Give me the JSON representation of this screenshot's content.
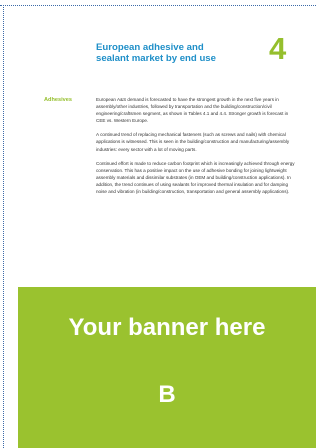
{
  "header": {
    "title_line1": "European adhesive and",
    "title_line2": "sealant market by end use",
    "chapter_number": "4"
  },
  "sidebar": {
    "label": "Adhesives"
  },
  "body": {
    "paragraphs": [
      "European A&S demand is forecasted to have the strongest growth in the next five years in assembly/other industries, followed by transportation and the building/construction/civil engineering/craftsmen segment, as shown in Tables 4.1 and 4.4. Stronger growth is forecast in CEE vs. Western Europe.",
      "A continued trend of replacing mechanical fasteners (such as screws and nails) with chemical applications is witnessed. This is seen in the building/construction and manufacturing/assembly industries: every sector with a lot of moving parts.",
      "Continued effort is made to reduce carbon footprint which is increasingly achieved through energy conservation. This has a positive impact on the use of adhesive bonding for joining lightweight assembly materials and dissimilar substrates (in OEM and building/construction applications). In addition, the trend continues of using sealants for improved thermal insulation and for damping noise and vibration (in building/construction, transportation and general assembly applications)."
    ]
  },
  "banner": {
    "text": "Your banner here",
    "letter": "B",
    "color": "#9ac22f"
  },
  "colors": {
    "title_blue": "#1f8fc8",
    "accent_green": "#95bf2d",
    "border_dots": "#3b6aa8"
  }
}
